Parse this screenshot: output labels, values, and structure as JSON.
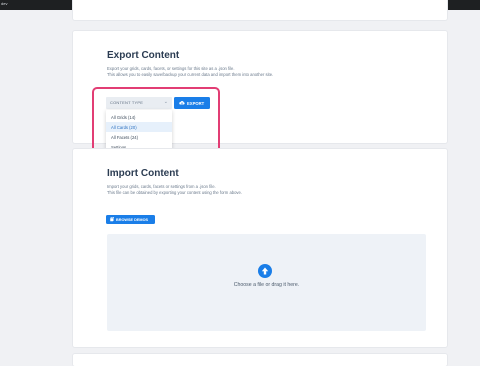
{
  "window": {
    "title": "dev"
  },
  "export": {
    "title": "Export Content",
    "description_line1": "Export your grids, cards, facets, or settings for this site as a .json file.",
    "description_line2": "This allows you to easily save/backup your current data and import them into another site.",
    "select": {
      "placeholder": "CONTENT TYPE",
      "options": [
        "All Grids (14)",
        "All Cards (20)",
        "All Facets (24)",
        "Settings"
      ],
      "highlighted_index": 1
    },
    "export_button": "EXPORT"
  },
  "import": {
    "title": "Import Content",
    "description_line1": "Import your grids, cards, facets or settings from a .json file.",
    "description_line2": "This file can be obtained by exporting your content using the form above.",
    "browse_button": "BROWSE DEMOS",
    "dropzone_text": "Choose a file or drag it here."
  },
  "colors": {
    "accent": "#1a7ee8",
    "highlight_outline": "#e23d74",
    "background": "#f0f1f4"
  },
  "icons": {
    "export": "cloud-download-icon",
    "browse": "copy-icon",
    "upload": "cloud-upload-icon",
    "dropdown": "chevron-down-icon"
  }
}
